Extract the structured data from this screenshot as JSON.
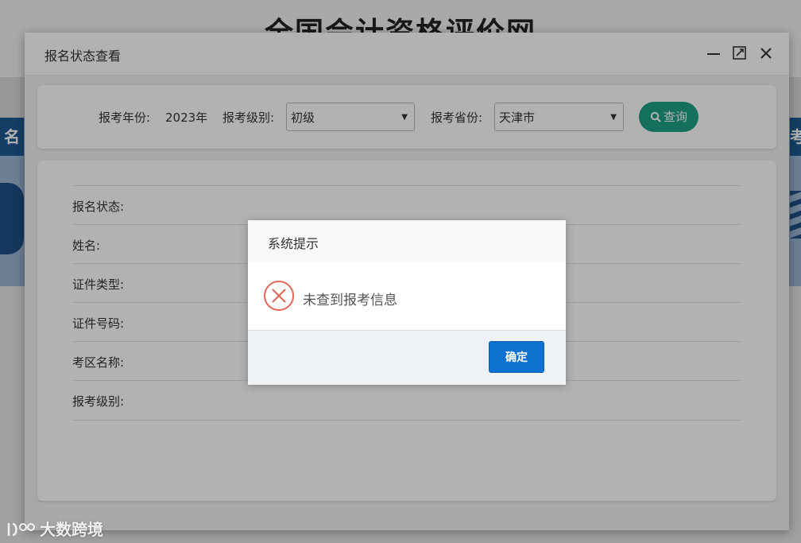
{
  "background": {
    "site_title": "全国会计资格评价网",
    "left_tab": "名",
    "right_tab": "考"
  },
  "window": {
    "title": "报名状态查看",
    "controls": {
      "minimize": "minimize-icon",
      "maximize": "maximize-icon",
      "close": "close-icon"
    }
  },
  "filters": {
    "year_label": "报考年份:",
    "year_value": "2023年",
    "level_label": "报考级别:",
    "level_value": "初级",
    "province_label": "报考省份:",
    "province_value": "天津市",
    "query_button": "查询"
  },
  "info_fields": [
    {
      "label": "报名状态:"
    },
    {
      "label": "姓名:"
    },
    {
      "label": "证件类型:"
    },
    {
      "label": "证件号码:"
    },
    {
      "label": "考区名称:"
    },
    {
      "label": "报考级别:"
    }
  ],
  "dialog": {
    "title": "系统提示",
    "message": "未查到报考信息",
    "ok_button": "确定",
    "icon": "error-circle-icon"
  },
  "watermark": "大数跨境",
  "colors": {
    "query_button": "#1f9f86",
    "ok_button": "#0d72cf",
    "error_icon": "#e0675a"
  }
}
